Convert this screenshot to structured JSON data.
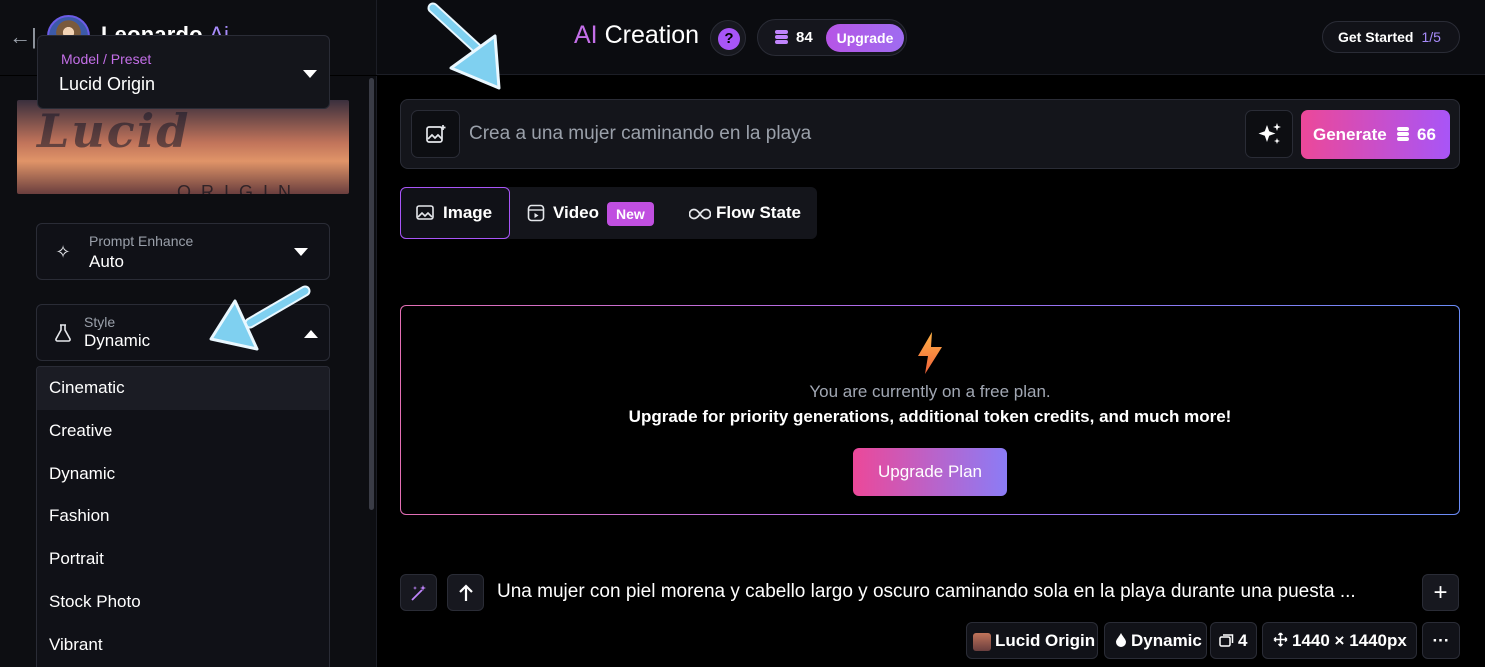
{
  "header": {
    "brand": "Leonardo.",
    "brand_ai": "Ai",
    "title_ai": "AI",
    "title_rest": " Creation",
    "help": "?",
    "credits": "84",
    "upgrade_label": "Upgrade",
    "get_started_label": "Get Started",
    "get_started_progress": "1/5"
  },
  "sidebar": {
    "model_label": "Model / Preset",
    "model_value": "Lucid Origin",
    "model_banner_text": "ORIGIN",
    "prompt_enhance_label": "Prompt Enhance",
    "prompt_enhance_value": "Auto",
    "style_label": "Style",
    "style_value": "Dynamic",
    "style_options": [
      "Cinematic",
      "Creative",
      "Dynamic",
      "Fashion",
      "Portrait",
      "Stock Photo",
      "Vibrant"
    ]
  },
  "prompt": {
    "placeholder": "Crea a una mujer caminando en la playa",
    "generate_label": "Generate",
    "generate_cost": "66"
  },
  "tabs": {
    "image": "Image",
    "video": "Video",
    "video_badge": "New",
    "flow": "Flow State"
  },
  "promo": {
    "line1": "You are currently on a free plan.",
    "line2": "Upgrade for priority generations, additional token credits, and much more!",
    "button": "Upgrade Plan"
  },
  "history": {
    "prompt": "Una mujer con piel morena y cabello largo y oscuro caminando sola en la playa durante una puesta ...",
    "model": "Lucid Origin",
    "style": "Dynamic",
    "count": "4",
    "size": "1440 × 1440px",
    "more": "···"
  },
  "colors": {
    "accent_purple": "#a855f7",
    "accent_pink": "#ec4899",
    "annotation_arrow": "#7fd0f0"
  }
}
